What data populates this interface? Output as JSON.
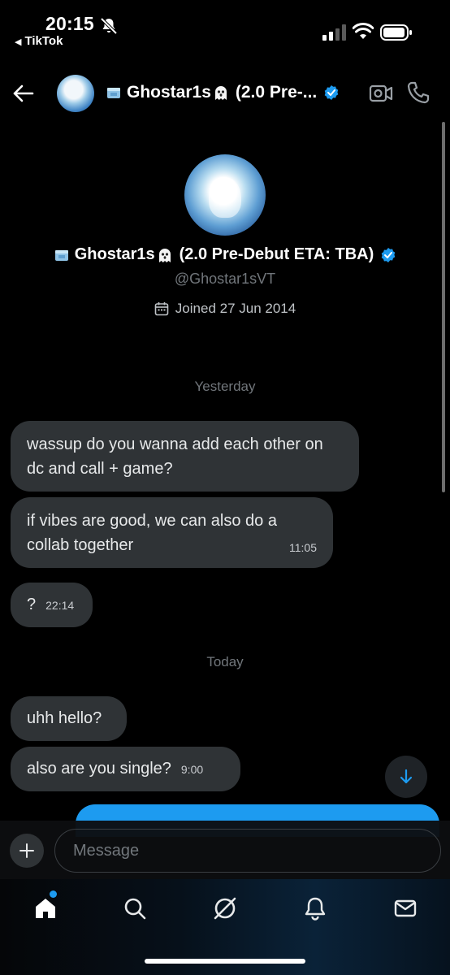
{
  "status_bar": {
    "time": "20:15",
    "back_app": "TikTok"
  },
  "header": {
    "name": "Ghostar1s",
    "name_suffix": "(2.0 Pre-...",
    "icons": [
      "back-arrow-icon",
      "video-camera-icon",
      "phone-icon",
      "verified-badge-icon"
    ]
  },
  "profile": {
    "name": "Ghostar1s",
    "name_suffix": "(2.0 Pre-Debut ETA: TBA)",
    "handle": "@Ghostar1sVT",
    "joined": "Joined 27 Jun 2014"
  },
  "conversation": {
    "separators": [
      "Yesterday",
      "Today"
    ],
    "messages": [
      {
        "text": "wassup do you wanna add each other on dc and call + game?",
        "time": ""
      },
      {
        "text": "if vibes are good, we can also do a collab together",
        "time": "11:05"
      },
      {
        "text": "?",
        "time": "22:14"
      },
      {
        "text": "uhh hello?",
        "time": ""
      },
      {
        "text": "also are you single?",
        "time": "9:00"
      }
    ]
  },
  "composer": {
    "placeholder": "Message"
  },
  "tabbar": {
    "items": [
      "home-icon",
      "search-icon",
      "grok-icon",
      "notifications-icon",
      "messages-icon"
    ]
  },
  "colors": {
    "background": "#000000",
    "bubble_incoming": "#2f3336",
    "accent": "#1d9bf0",
    "muted_text": "#71767b"
  }
}
